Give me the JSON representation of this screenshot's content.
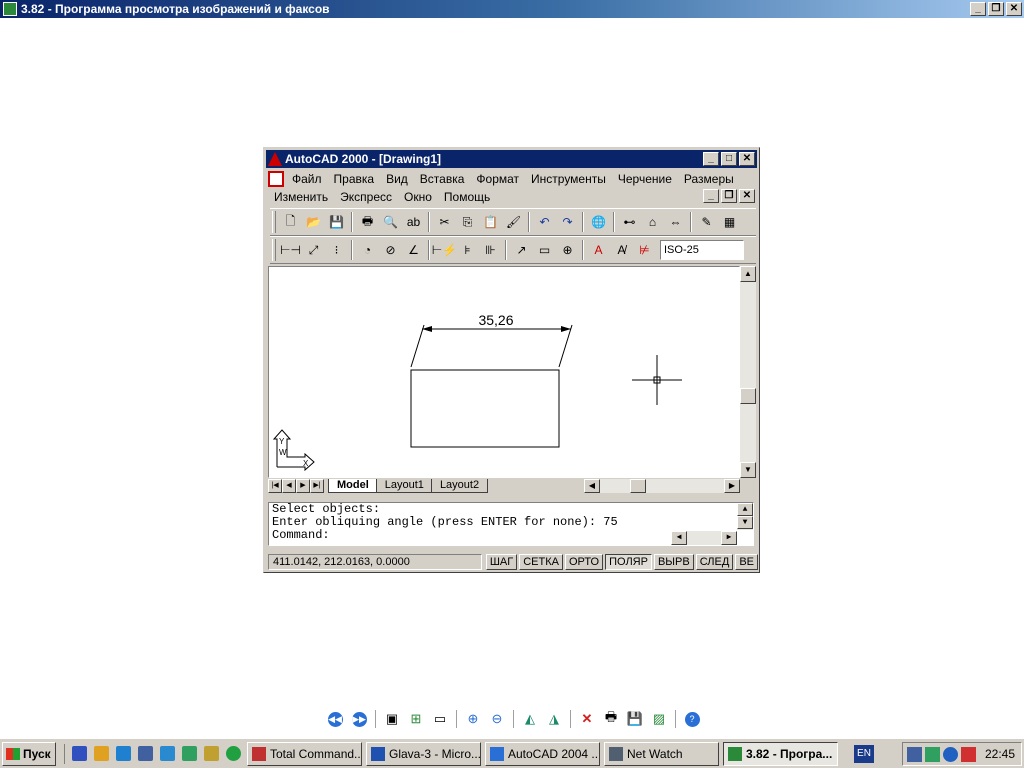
{
  "viewer": {
    "title": "3.82 - Программа просмотра изображений и факсов"
  },
  "acad": {
    "title": "AutoCAD 2000 - [Drawing1]",
    "menu1": [
      "Файл",
      "Правка",
      "Вид",
      "Вставка",
      "Формат",
      "Инструменты",
      "Черчение",
      "Размеры"
    ],
    "menu2": [
      "Изменить",
      "Экспресс",
      "Окно",
      "Помощь"
    ],
    "dim_style": "ISO-25",
    "dimension_text": "35,26",
    "tabs": [
      "Model",
      "Layout1",
      "Layout2"
    ],
    "command_lines": [
      "Select objects:",
      "Enter obliquing angle (press ENTER for none): 75",
      "Command:"
    ],
    "coords": "411.0142, 212.0163, 0.0000",
    "status_buttons": [
      {
        "label": "ШАГ",
        "on": false
      },
      {
        "label": "СЕТКА",
        "on": false
      },
      {
        "label": "ОРТО",
        "on": false
      },
      {
        "label": "ПОЛЯР",
        "on": true
      },
      {
        "label": "ВЫРВ",
        "on": false
      },
      {
        "label": "СЛЕД",
        "on": false
      },
      {
        "label": "ВЕ",
        "on": false
      }
    ],
    "ucs": {
      "y": "Y",
      "w": "W",
      "x": "X"
    }
  },
  "taskbar": {
    "start": "Пуск",
    "tasks": [
      {
        "label": "Total Command...",
        "active": false
      },
      {
        "label": "Glava-3 - Micro...",
        "active": false
      },
      {
        "label": "AutoCAD 2004 ...",
        "active": false
      },
      {
        "label": "Net Watch",
        "active": false
      },
      {
        "label": "3.82 - Програ...",
        "active": true
      }
    ],
    "lang": "EN",
    "clock": "22:45"
  }
}
